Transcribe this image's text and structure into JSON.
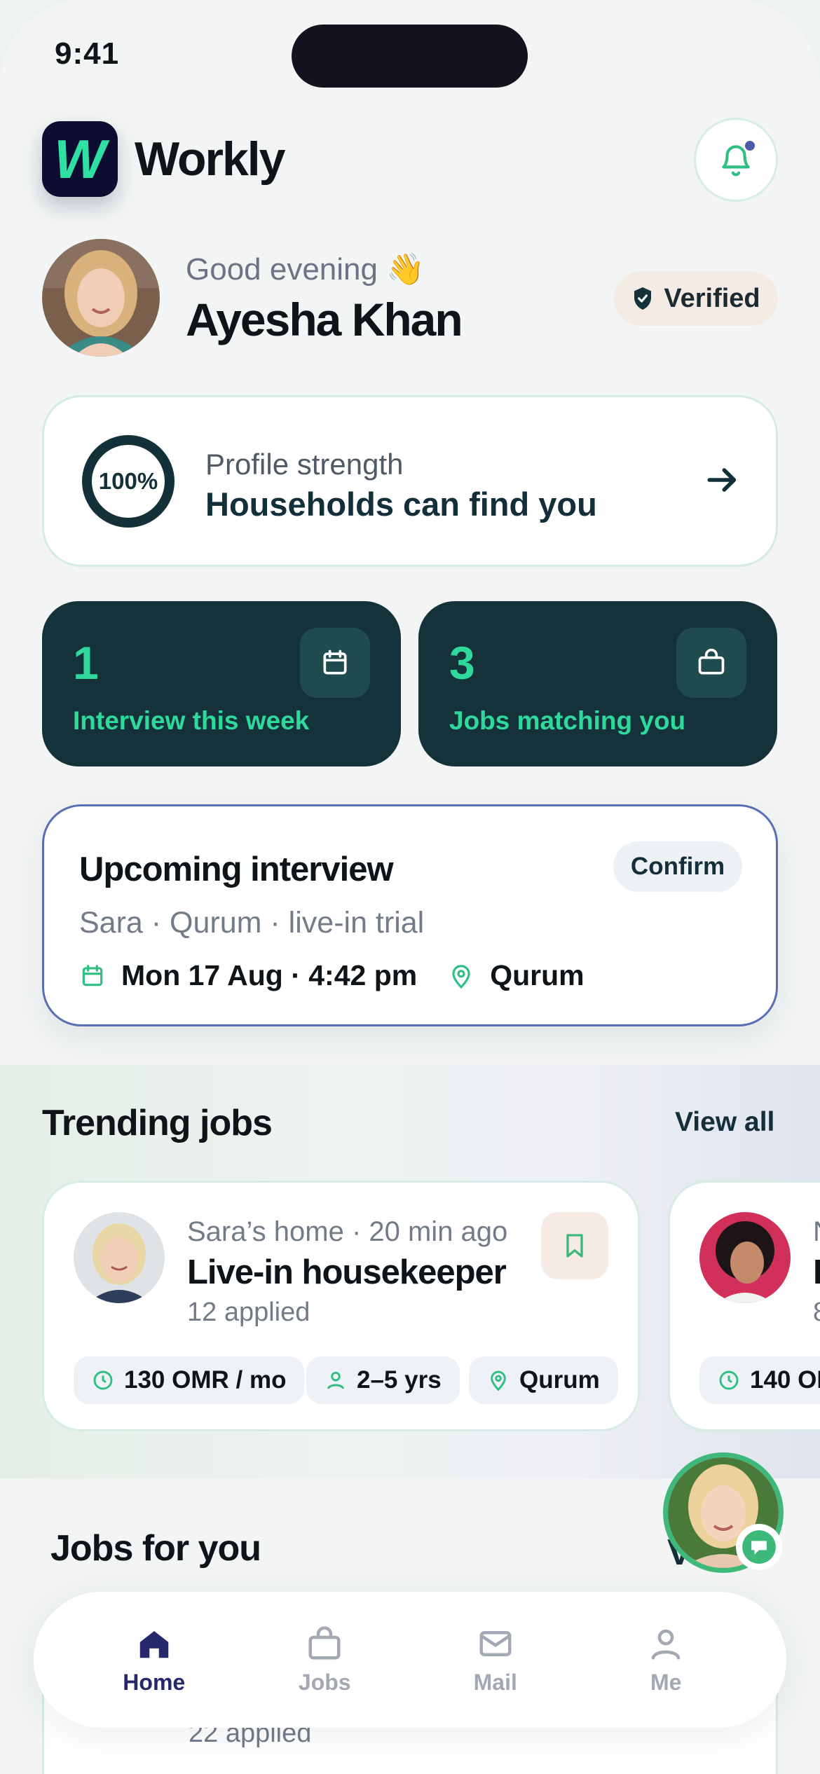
{
  "status_bar": {
    "time": "9:41"
  },
  "header": {
    "logo_letter": "W",
    "app_name": "Workly"
  },
  "greeting": {
    "salutation": "Good evening 👋",
    "user_name": "Ayesha Khan",
    "badge": "Verified"
  },
  "profile": {
    "percent": "100%",
    "label": "Profile strength",
    "title": "Households can find you"
  },
  "stats": [
    {
      "value": "1",
      "label": "Interview this week",
      "icon": "calendar-icon"
    },
    {
      "value": "3",
      "label": "Jobs matching you",
      "icon": "briefcase-icon"
    }
  ],
  "interview": {
    "title": "Upcoming interview",
    "confirm_label": "Confirm",
    "subtitle": "Sara · Qurum · live-in trial",
    "datetime": "Mon 17 Aug · 4:42 pm",
    "location": "Qurum"
  },
  "trending": {
    "title": "Trending jobs",
    "view_all": "View all",
    "jobs": [
      {
        "meta": "Sara’s home · 20 min ago",
        "title": "Live-in housekeeper",
        "applied": "12 applied",
        "salary": "130 OMR / mo",
        "experience": "2–5 yrs",
        "location": "Qurum"
      },
      {
        "meta": "N",
        "title": "L",
        "applied": "8",
        "salary": "140 OM"
      }
    ]
  },
  "jobs_for_you": {
    "title": "Jobs for you",
    "view_all": "V",
    "applied": "22 applied"
  },
  "nav": [
    {
      "label": "Home",
      "icon": "home-icon",
      "active": true
    },
    {
      "label": "Jobs",
      "icon": "briefcase-icon",
      "active": false
    },
    {
      "label": "Mail",
      "icon": "mail-icon",
      "active": false
    },
    {
      "label": "Me",
      "icon": "person-icon",
      "active": false
    }
  ],
  "colors": {
    "accent": "#2fd89b",
    "dark_card": "#15313a",
    "nav_active": "#25286a",
    "brand_bg": "#0d0d34"
  }
}
